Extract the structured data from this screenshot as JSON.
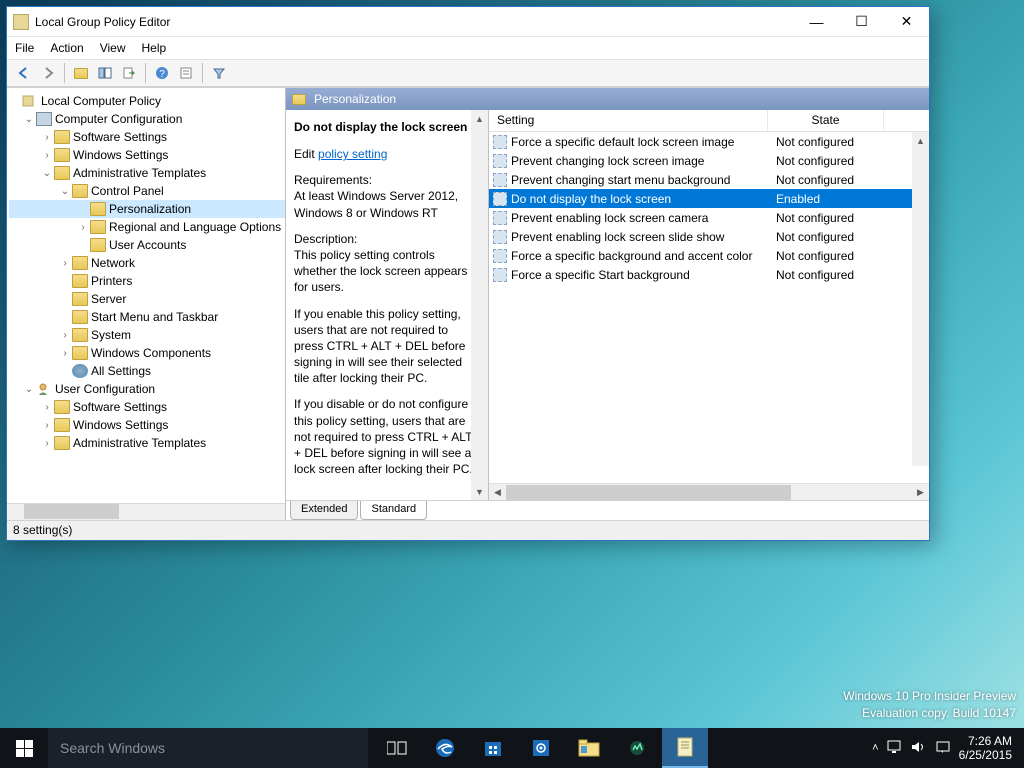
{
  "window": {
    "title": "Local Group Policy Editor",
    "menus": [
      "File",
      "Action",
      "View",
      "Help"
    ],
    "status": "8 setting(s)"
  },
  "tree": {
    "root": "Local Computer Policy",
    "cc": "Computer Configuration",
    "cc_items": {
      "ss": "Software Settings",
      "ws": "Windows Settings",
      "at": "Administrative Templates",
      "cp": "Control Panel",
      "pers": "Personalization",
      "rlo": "Regional and Language Options",
      "ua": "User Accounts",
      "net": "Network",
      "prn": "Printers",
      "srv": "Server",
      "smt": "Start Menu and Taskbar",
      "sys": "System",
      "wcp": "Windows Components",
      "all": "All Settings"
    },
    "uc": "User Configuration",
    "uc_items": {
      "ss": "Software Settings",
      "ws": "Windows Settings",
      "at": "Administrative Templates"
    }
  },
  "path": "Personalization",
  "desc": {
    "title": "Do not display the lock screen",
    "edit_prefix": "Edit ",
    "edit_link": "policy setting",
    "req_label": "Requirements:",
    "req_text": "At least Windows Server 2012, Windows 8 or Windows RT",
    "d_label": "Description:",
    "d_p1": "This policy setting controls whether the lock screen appears for users.",
    "d_p2": "If you enable this policy setting, users that are not required to press CTRL + ALT + DEL before signing in will see their selected tile after locking their PC.",
    "d_p3": "If you disable or do not configure this policy setting, users that are not required to press CTRL + ALT + DEL before signing in will see a lock screen after locking their PC."
  },
  "list": {
    "col_setting": "Setting",
    "col_state": "State",
    "rows": [
      {
        "name": "Force a specific default lock screen image",
        "state": "Not configured",
        "sel": false
      },
      {
        "name": "Prevent changing lock screen image",
        "state": "Not configured",
        "sel": false
      },
      {
        "name": "Prevent changing start menu background",
        "state": "Not configured",
        "sel": false
      },
      {
        "name": "Do not display the lock screen",
        "state": "Enabled",
        "sel": true
      },
      {
        "name": "Prevent enabling lock screen camera",
        "state": "Not configured",
        "sel": false
      },
      {
        "name": "Prevent enabling lock screen slide show",
        "state": "Not configured",
        "sel": false
      },
      {
        "name": "Force a specific background and accent color",
        "state": "Not configured",
        "sel": false
      },
      {
        "name": "Force a specific Start background",
        "state": "Not configured",
        "sel": false
      }
    ]
  },
  "tabs": {
    "extended": "Extended",
    "standard": "Standard"
  },
  "taskbar": {
    "search_placeholder": "Search Windows",
    "time": "7:26 AM",
    "date": "6/25/2015"
  },
  "overlay": {
    "l1": "Windows 10 Pro Insider Preview",
    "l2": "Evaluation copy. Build 10147"
  }
}
